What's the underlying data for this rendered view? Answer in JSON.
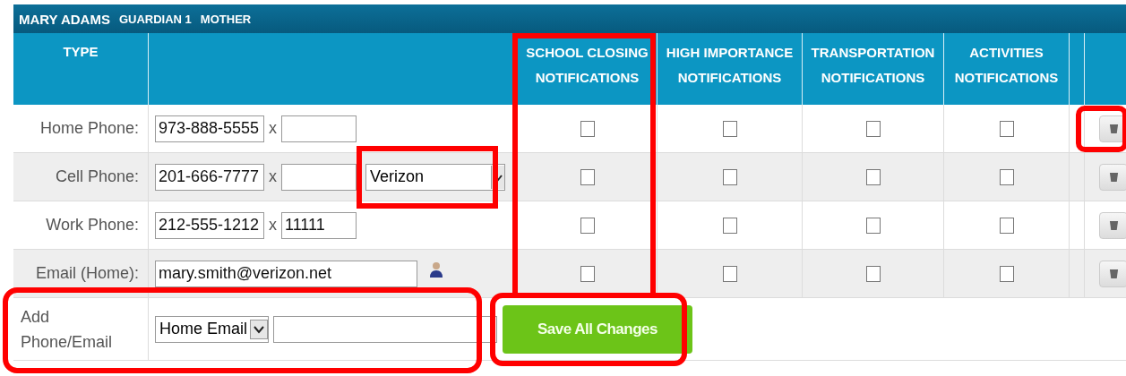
{
  "contact": {
    "name": "MARY ADAMS",
    "role": "GUARDIAN 1",
    "relation": "MOTHER"
  },
  "columns": {
    "type": "TYPE",
    "notifications": [
      {
        "label": "SCHOOL CLOSING NOTIFICATIONS",
        "highlighted": true
      },
      {
        "label": "HIGH IMPORTANCE NOTIFICATIONS",
        "highlighted": false
      },
      {
        "label": "TRANSPORTATION NOTIFICATIONS",
        "highlighted": false
      },
      {
        "label": "ACTIVITIES NOTIFICATIONS",
        "highlighted": false
      }
    ]
  },
  "rows": [
    {
      "kind": "phone",
      "type": "Home Phone:",
      "value": "973-888-5555",
      "separator": "x",
      "notifications": [
        {
          "checked": false
        },
        {
          "checked": false
        },
        {
          "checked": false
        },
        {
          "checked": false
        }
      ],
      "delete_highlighted": true
    },
    {
      "kind": "phone",
      "type": "Cell Phone:",
      "value": "201-666-7777",
      "separator": "x",
      "carrier": "Verizon",
      "carrier_highlighted": true,
      "notifications": [
        {
          "checked": false
        },
        {
          "checked": false
        },
        {
          "checked": false
        },
        {
          "checked": false
        }
      ],
      "delete_highlighted": false
    },
    {
      "kind": "phone",
      "type": "Work Phone:",
      "value": "212-555-1212",
      "separator": "x",
      "extension": "11111",
      "notifications": [
        {
          "checked": false
        },
        {
          "checked": false
        },
        {
          "checked": false
        },
        {
          "checked": false
        }
      ],
      "delete_highlighted": false
    },
    {
      "kind": "email",
      "type": "Email (Home):",
      "value": "mary.smith@verizon.net",
      "notifications": [
        {
          "checked": false
        },
        {
          "checked": false
        },
        {
          "checked": false
        },
        {
          "checked": false
        }
      ],
      "delete_highlighted": false
    }
  ],
  "add_row": {
    "label": "Add Phone/Email",
    "type_select": "Home Email",
    "highlighted": true
  },
  "save_button": {
    "label": "Save All Changes",
    "highlighted": true
  }
}
